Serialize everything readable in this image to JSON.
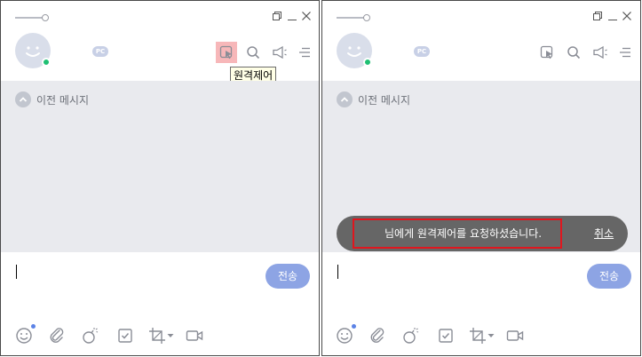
{
  "left_panel": {
    "tooltip": "원격제어",
    "previous_messages": "이전 메시지",
    "pc_badge": "PC",
    "send_label": "전송"
  },
  "right_panel": {
    "previous_messages": "이전 메시지",
    "pc_badge": "PC",
    "send_label": "전송",
    "notice_message": "님에게 원격제어를 요청하셨습니다.",
    "cancel_label": "취소"
  },
  "icons": {
    "window": [
      "restore-icon",
      "minimize-icon",
      "close-icon"
    ],
    "header_tools": [
      "remote-control-icon",
      "search-icon",
      "announcement-icon",
      "menu-icon"
    ],
    "bottom_tools": [
      "emoji-icon",
      "attach-icon",
      "bomb-icon",
      "check-icon",
      "crop-icon",
      "video-icon"
    ]
  },
  "colors": {
    "send_button": "#8da4e4",
    "chat_bg": "#e9eaee",
    "status_online": "#1fbf73",
    "highlight": "#f7b7b9",
    "notice_bg": "#666666",
    "annotation_box": "#e0161e"
  }
}
